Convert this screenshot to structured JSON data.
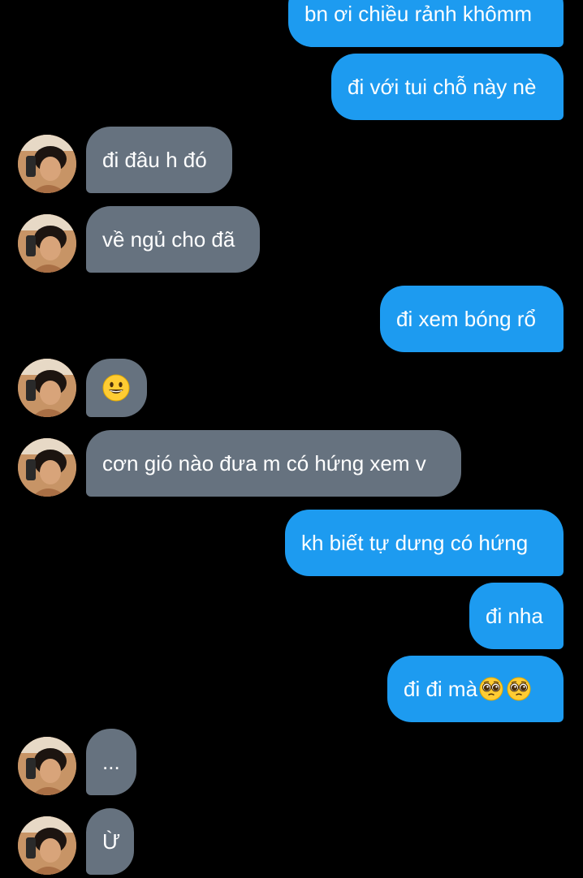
{
  "messages": [
    {
      "side": "out",
      "text": "bn ơi chiều rảnh khômm"
    },
    {
      "side": "out",
      "text": "đi với tui chỗ này nè"
    },
    {
      "side": "in",
      "text": "đi đâu h đó"
    },
    {
      "side": "in",
      "text": "về ngủ cho đã"
    },
    {
      "side": "out",
      "text": "đi xem bóng rổ"
    },
    {
      "side": "in",
      "emoji": "grinning-face-emoji"
    },
    {
      "side": "in",
      "text": "cơn gió nào đưa m có hứng xem v"
    },
    {
      "side": "out",
      "text": "kh biết tự dưng có hứng"
    },
    {
      "side": "out",
      "text": "đi nha"
    },
    {
      "side": "out",
      "text": "đi đi mà",
      "trailing_emoji": [
        "pleading-face-emoji",
        "pleading-face-emoji"
      ]
    },
    {
      "side": "in",
      "text": "..."
    },
    {
      "side": "in",
      "text": "Ừ"
    }
  ],
  "colors": {
    "background": "#000000",
    "outgoing_bubble": "#1d9bf0",
    "incoming_bubble": "#66727f",
    "text": "#ffffff"
  },
  "avatar": {
    "icon": "contact-avatar"
  }
}
